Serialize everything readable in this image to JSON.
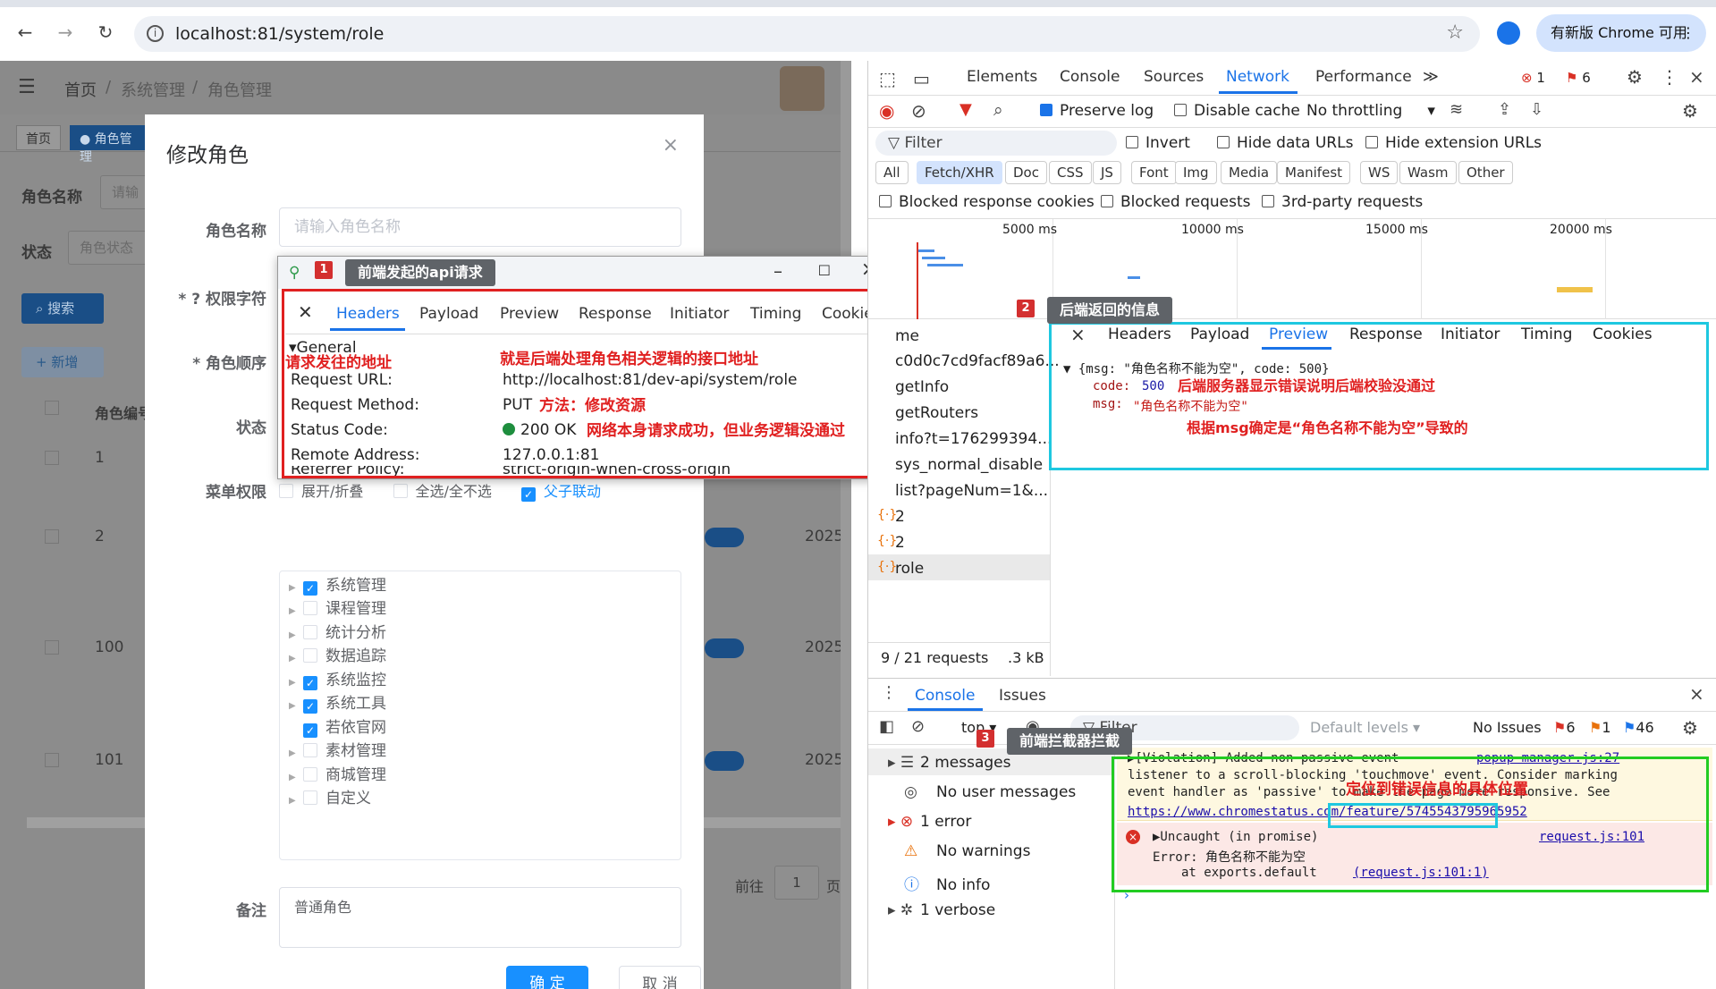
{
  "browser": {
    "url": "localhost:81/system/role",
    "update_label": "有新版 Chrome 可用"
  },
  "app": {
    "breadcrumb": [
      "首页",
      "系统管理",
      "角色管理"
    ],
    "tags": [
      "首页",
      "● 角色管理"
    ],
    "search": {
      "role_name_label": "角色名称",
      "role_name_placeholder": "请输",
      "status_label": "状态",
      "status_placeholder": "角色状态",
      "search_button": "搜索",
      "add_button": "+ 新增"
    },
    "table": {
      "header": "角色编号",
      "rows": [
        {
          "id": "1",
          "date": ""
        },
        {
          "id": "2",
          "date": "2025-"
        },
        {
          "id": "100",
          "date": "2025-"
        },
        {
          "id": "101",
          "date": "2025-"
        }
      ]
    },
    "pagination": {
      "goto_label": "前往",
      "page": "1",
      "page_suffix": "页"
    }
  },
  "dialog": {
    "title": "修改角色",
    "role_name_label": "角色名称",
    "role_name_placeholder": "请输入角色名称",
    "perm_label": "* ? 权限字符",
    "order_label": "* 角色顺序",
    "status_label": "状态",
    "menu_label": "菜单权限",
    "tree_options": [
      "展开/折叠",
      "全选/全不选",
      "父子联动"
    ],
    "tree": [
      {
        "label": "系统管理",
        "checked": true,
        "arrow": true
      },
      {
        "label": "课程管理",
        "checked": false,
        "arrow": true
      },
      {
        "label": "统计分析",
        "checked": false,
        "arrow": true
      },
      {
        "label": "数据追踪",
        "checked": false,
        "arrow": true
      },
      {
        "label": "系统监控",
        "checked": true,
        "arrow": true
      },
      {
        "label": "系统工具",
        "checked": true,
        "arrow": true
      },
      {
        "label": "若依官网",
        "checked": true,
        "arrow": false
      },
      {
        "label": "素材管理",
        "checked": false,
        "arrow": true
      },
      {
        "label": "商城管理",
        "checked": false,
        "arrow": true
      },
      {
        "label": "自定义",
        "checked": false,
        "arrow": true
      }
    ],
    "remark_label": "备注",
    "remark_value": "普通角色",
    "ok_button": "确 定",
    "cancel_button": "取 消"
  },
  "popup": {
    "tabs": [
      "Headers",
      "Payload",
      "Preview",
      "Response",
      "Initiator",
      "Timing",
      "Cookies"
    ],
    "active_tab": "Headers",
    "section": "General",
    "rows": [
      {
        "key": "Request URL:",
        "value": "http://localhost:81/dev-api/system/role"
      },
      {
        "key": "Request Method:",
        "value": "PUT"
      },
      {
        "key": "Status Code:",
        "value": "200 OK"
      },
      {
        "key": "Remote Address:",
        "value": "127.0.0.1:81"
      },
      {
        "key": "Referrer Policy:",
        "value": "strict-origin-when-cross-origin"
      }
    ]
  },
  "annotations": {
    "callout1": "前端发起的api请求",
    "callout2": "后端返回的信息",
    "callout3": "前端拦截器拦截",
    "badge1": "1",
    "badge2": "2",
    "badge3": "3",
    "req_addr": "请求发往的地址",
    "api_desc": "就是后端处理角色相关逻辑的接口地址",
    "method_desc": "方法：修改资源",
    "status_desc": "网络本身请求成功，但业务逻辑没通过",
    "code_desc": "后端服务器显示错误说明后端校验没通过",
    "msg_desc": "根据msg确定是“角色名称不能为空”导致的",
    "error_desc": "定位到错误信息的具体位置"
  },
  "devtools": {
    "tabs": [
      "Elements",
      "Console",
      "Sources",
      "Network",
      "Performance"
    ],
    "active_tab": "Network",
    "error_count": "1",
    "warn_count": "6",
    "toolbar": {
      "preserve_log": "Preserve log",
      "disable_cache": "Disable cache",
      "throttling": "No throttling"
    },
    "filter": {
      "placeholder": "Filter",
      "invert": "Invert",
      "hide_data": "Hide data URLs",
      "hide_ext": "Hide extension URLs"
    },
    "type_filters": [
      "All",
      "Fetch/XHR",
      "Doc",
      "CSS",
      "JS",
      "Font",
      "Img",
      "Media",
      "Manifest",
      "WS",
      "Wasm",
      "Other"
    ],
    "active_type": "Fetch/XHR",
    "blocked": {
      "cookies": "Blocked response cookies",
      "requests": "Blocked requests",
      "third": "3rd-party requests"
    },
    "timeline_ticks": [
      "5000 ms",
      "10000 ms",
      "15000 ms",
      "20000 ms"
    ],
    "req_header": "me",
    "requests": [
      "c0d0c7cd9facf89a6...",
      "getInfo",
      "getRouters",
      "info?t=176299394...",
      "sys_normal_disable",
      "list?pageNum=1&...",
      "2",
      "2",
      "role"
    ],
    "summary": "9 / 21 requests",
    "size": ".3 kB",
    "detail_tabs": [
      "Headers",
      "Payload",
      "Preview",
      "Response",
      "Initiator",
      "Timing",
      "Cookies"
    ],
    "detail_active": "Preview",
    "preview": {
      "line1": "▼ {msg: \"角色名称不能为空\", code: 500}",
      "code_key": "code:",
      "code_val": "500",
      "msg_key": "msg:",
      "msg_val": "\"角色名称不能为空\""
    },
    "console": {
      "tabs": [
        "Console",
        "Issues"
      ],
      "context": "top ▾",
      "filter": "Filter",
      "levels": "Default levels ▾",
      "no_issues": "No Issues",
      "counts": [
        "6",
        "1",
        "46"
      ],
      "sidebar": [
        "2 messages",
        "No user messages",
        "1 error",
        "No warnings",
        "No info",
        "1 verbose"
      ],
      "violation_1": "▶[Violation] Added non-passive event",
      "violation_2": "listener to a scroll-blocking 'touchmove' event. Consider marking",
      "violation_3": "event handler as 'passive' to make the page more responsive. See",
      "violation_4": "https://www.chromestatus.com/feature/5745543795965952",
      "violation_link": "popup-manager.js:27",
      "error_1": "▶Uncaught (in promise)",
      "error_2": "Error: 角色名称不能为空",
      "error_3": "at exports.default",
      "error_loc": "(request.js:101:1)",
      "error_link": "request.js:101"
    }
  }
}
